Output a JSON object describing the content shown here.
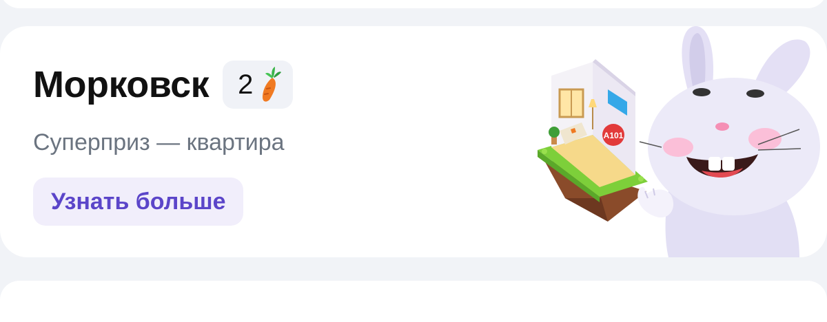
{
  "card": {
    "title": "Морковск",
    "badge_count": "2",
    "badge_icon": "carrot-icon",
    "subtitle": "Суперприз — квартира",
    "button_label": "Узнать больше",
    "island_sign": "A101"
  },
  "colors": {
    "page_bg": "#f1f3f7",
    "card_bg": "#ffffff",
    "title": "#111111",
    "subtitle": "#6b7480",
    "button_bg": "#f1eefb",
    "button_text": "#5b45c9",
    "carrot": "#f07a22"
  }
}
